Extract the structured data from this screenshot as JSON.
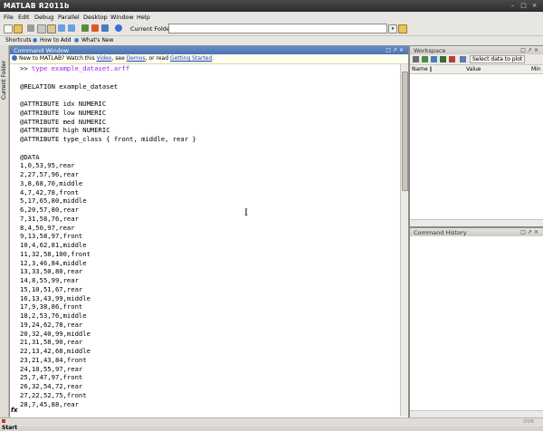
{
  "app": {
    "title": "MATLAB  R2011b"
  },
  "menu": [
    "File",
    "Edit",
    "Debug",
    "Parallel",
    "Desktop",
    "Window",
    "Help"
  ],
  "toolbar": {
    "current_folder_label": "Current Folder:",
    "current_folder_value": ""
  },
  "shortcuts": {
    "shortcuts_label": "Shortcuts",
    "how_to_add": "How to Add",
    "whats_new": "What's New"
  },
  "sidebar": {
    "current_folder_tab": "Current Folder"
  },
  "command_window": {
    "title": "Command Window",
    "info_prefix": "New to MATLAB? Watch this ",
    "info_video": "Video",
    "info_mid1": ", see ",
    "info_demos": "Demos",
    "info_mid2": ", or read ",
    "info_started": "Getting Started",
    "info_suffix": ".",
    "prompt": ">> ",
    "command": "type example_dataset.arff",
    "lines": [
      "",
      "@RELATION example_dataset",
      "",
      "@ATTRIBUTE idx NUMERIC",
      "@ATTRIBUTE low NUMERIC",
      "@ATTRIBUTE med NUMERIC",
      "@ATTRIBUTE high NUMERIC",
      "@ATTRIBUTE type_class { front, middle, rear }",
      "",
      "@DATA",
      "1,0,53,95,rear",
      "2,27,57,96,rear",
      "3,8,68,70,middle",
      "4,7,42,78,front",
      "5,17,65,80,middle",
      "6,20,57,80,rear",
      "7,31,58,76,rear",
      "8,4,50,97,rear",
      "9,13,58,97,front",
      "10,4,62,81,middle",
      "11,32,58,100,front",
      "12,3,46,84,middle",
      "13,33,50,80,rear",
      "14,8,55,99,rear",
      "15,10,51,67,rear",
      "16,13,43,99,middle",
      "17,9,38,86,front",
      "18,2,53,76,middle",
      "19,24,62,78,rear",
      "20,32,40,99,middle",
      "21,31,58,90,rear",
      "22,13,42,68,middle",
      "23,21,43,84,front",
      "24,10,55,97,rear",
      "25,7,47,97,front",
      "26,32,54,72,rear",
      "27,22,52,75,front",
      "28,7,45,88,rear"
    ],
    "fx": "fx"
  },
  "workspace": {
    "title": "Workspace",
    "select_plot": "Select data to plot",
    "columns": [
      "Name ∥",
      "Value",
      "Min"
    ]
  },
  "history": {
    "title": "Command History"
  },
  "status": {
    "start": "Start",
    "ovr": "OVR"
  }
}
